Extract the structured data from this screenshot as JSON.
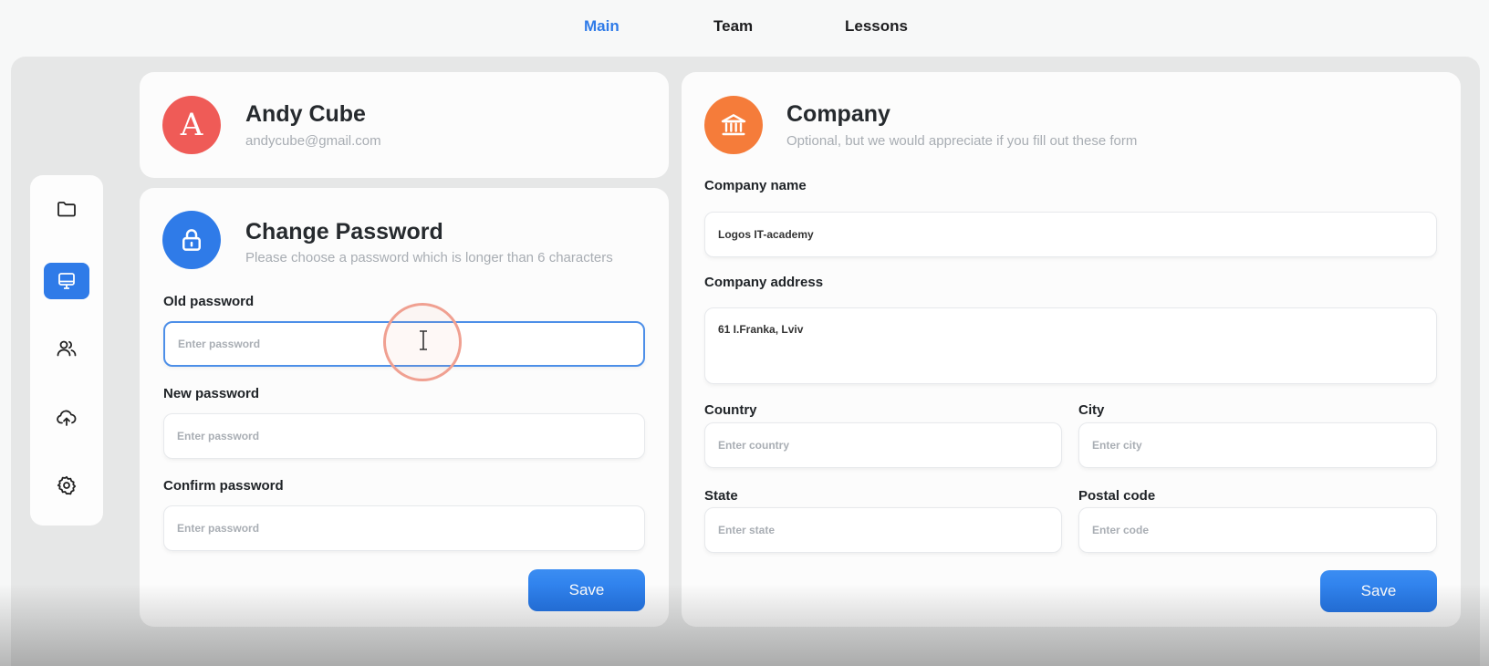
{
  "nav": {
    "tabs": [
      {
        "label": "Main",
        "active": true
      },
      {
        "label": "Team",
        "active": false
      },
      {
        "label": "Lessons",
        "active": false
      }
    ]
  },
  "sidebar": {
    "items": [
      {
        "icon": "folder-icon",
        "active": false
      },
      {
        "icon": "monitor-icon",
        "active": true
      },
      {
        "icon": "users-icon",
        "active": false
      },
      {
        "icon": "cloud-upload-icon",
        "active": false
      },
      {
        "icon": "gear-icon",
        "active": false
      }
    ]
  },
  "profile": {
    "initial": "A",
    "name": "Andy Cube",
    "email": "andycube@gmail.com",
    "avatar_color": "#ef5b57"
  },
  "password": {
    "title": "Change Password",
    "subtitle": "Please choose a password which is longer than 6 characters",
    "icon": "lock-icon",
    "icon_color": "#2f7be8",
    "old_label": "Old password",
    "old_placeholder": "Enter password",
    "new_label": "New password",
    "new_placeholder": "Enter password",
    "confirm_label": "Confirm password",
    "confirm_placeholder": "Enter password",
    "save_label": "Save"
  },
  "company": {
    "title": "Company",
    "subtitle": "Optional, but we would appreciate if you fill out these form",
    "icon": "bank-icon",
    "icon_color": "#f57c3a",
    "name_label": "Company name",
    "name_value": "Logos IT-academy",
    "address_label": "Company address",
    "address_value": "61 I.Franka, Lviv",
    "country_label": "Country",
    "country_placeholder": "Enter country",
    "city_label": "City",
    "city_placeholder": "Enter city",
    "state_label": "State",
    "state_placeholder": "Enter state",
    "postal_label": "Postal code",
    "postal_placeholder": "Enter code",
    "save_label": "Save"
  },
  "colors": {
    "accent": "#2f7be8",
    "frame": "#e6e7e7"
  }
}
